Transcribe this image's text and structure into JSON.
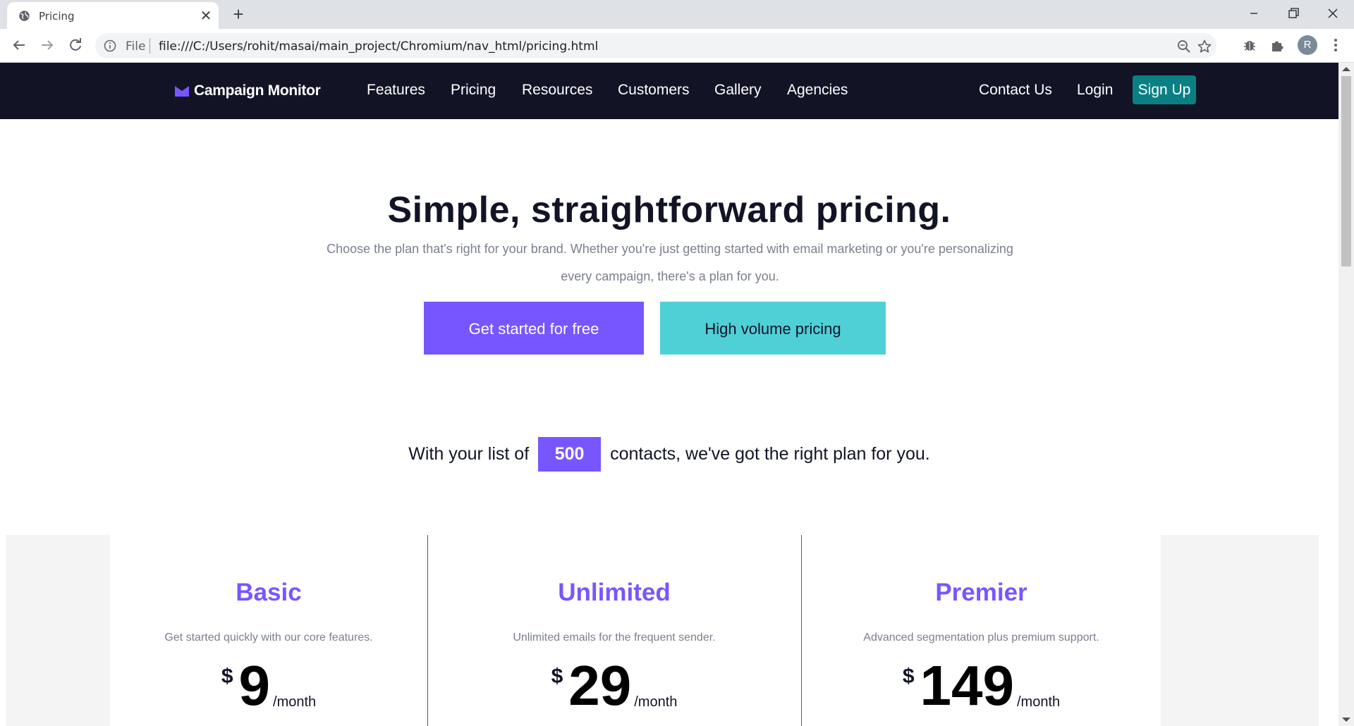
{
  "browser": {
    "tab_title": "Pricing",
    "omnibox_scheme_label": "File",
    "omnibox_url": "file:///C:/Users/rohit/masai/main_project/Chromium/nav_html/pricing.html",
    "profile_initial": "R"
  },
  "nav": {
    "logo_text": "Campaign Monitor",
    "links": [
      "Features",
      "Pricing",
      "Resources",
      "Customers",
      "Gallery",
      "Agencies"
    ],
    "contact": "Contact Us",
    "login": "Login",
    "signup": "Sign Up"
  },
  "hero": {
    "title": "Simple, straightforward pricing.",
    "subtitle": "Choose the plan that's right for your brand. Whether you're just getting started with email marketing or you're personalizing every campaign, there's a plan for you.",
    "cta_primary": "Get started for free",
    "cta_secondary": "High volume pricing"
  },
  "contacts": {
    "prefix": "With your list of",
    "count": "500",
    "suffix": "contacts, we've got the right plan for you."
  },
  "plans": [
    {
      "name": "Basic",
      "description": "Get started quickly with our core features.",
      "currency": "$",
      "price": "9",
      "period": "/month"
    },
    {
      "name": "Unlimited",
      "description": "Unlimited emails for the frequent sender.",
      "currency": "$",
      "price": "29",
      "period": "/month"
    },
    {
      "name": "Premier",
      "description": "Advanced segmentation plus premium support.",
      "currency": "$",
      "price": "149",
      "period": "/month"
    }
  ],
  "colors": {
    "nav_bg": "#121426",
    "brand_purple": "#7856ff",
    "teal_button": "#0a8083",
    "aqua_button": "#4fd0d6"
  }
}
